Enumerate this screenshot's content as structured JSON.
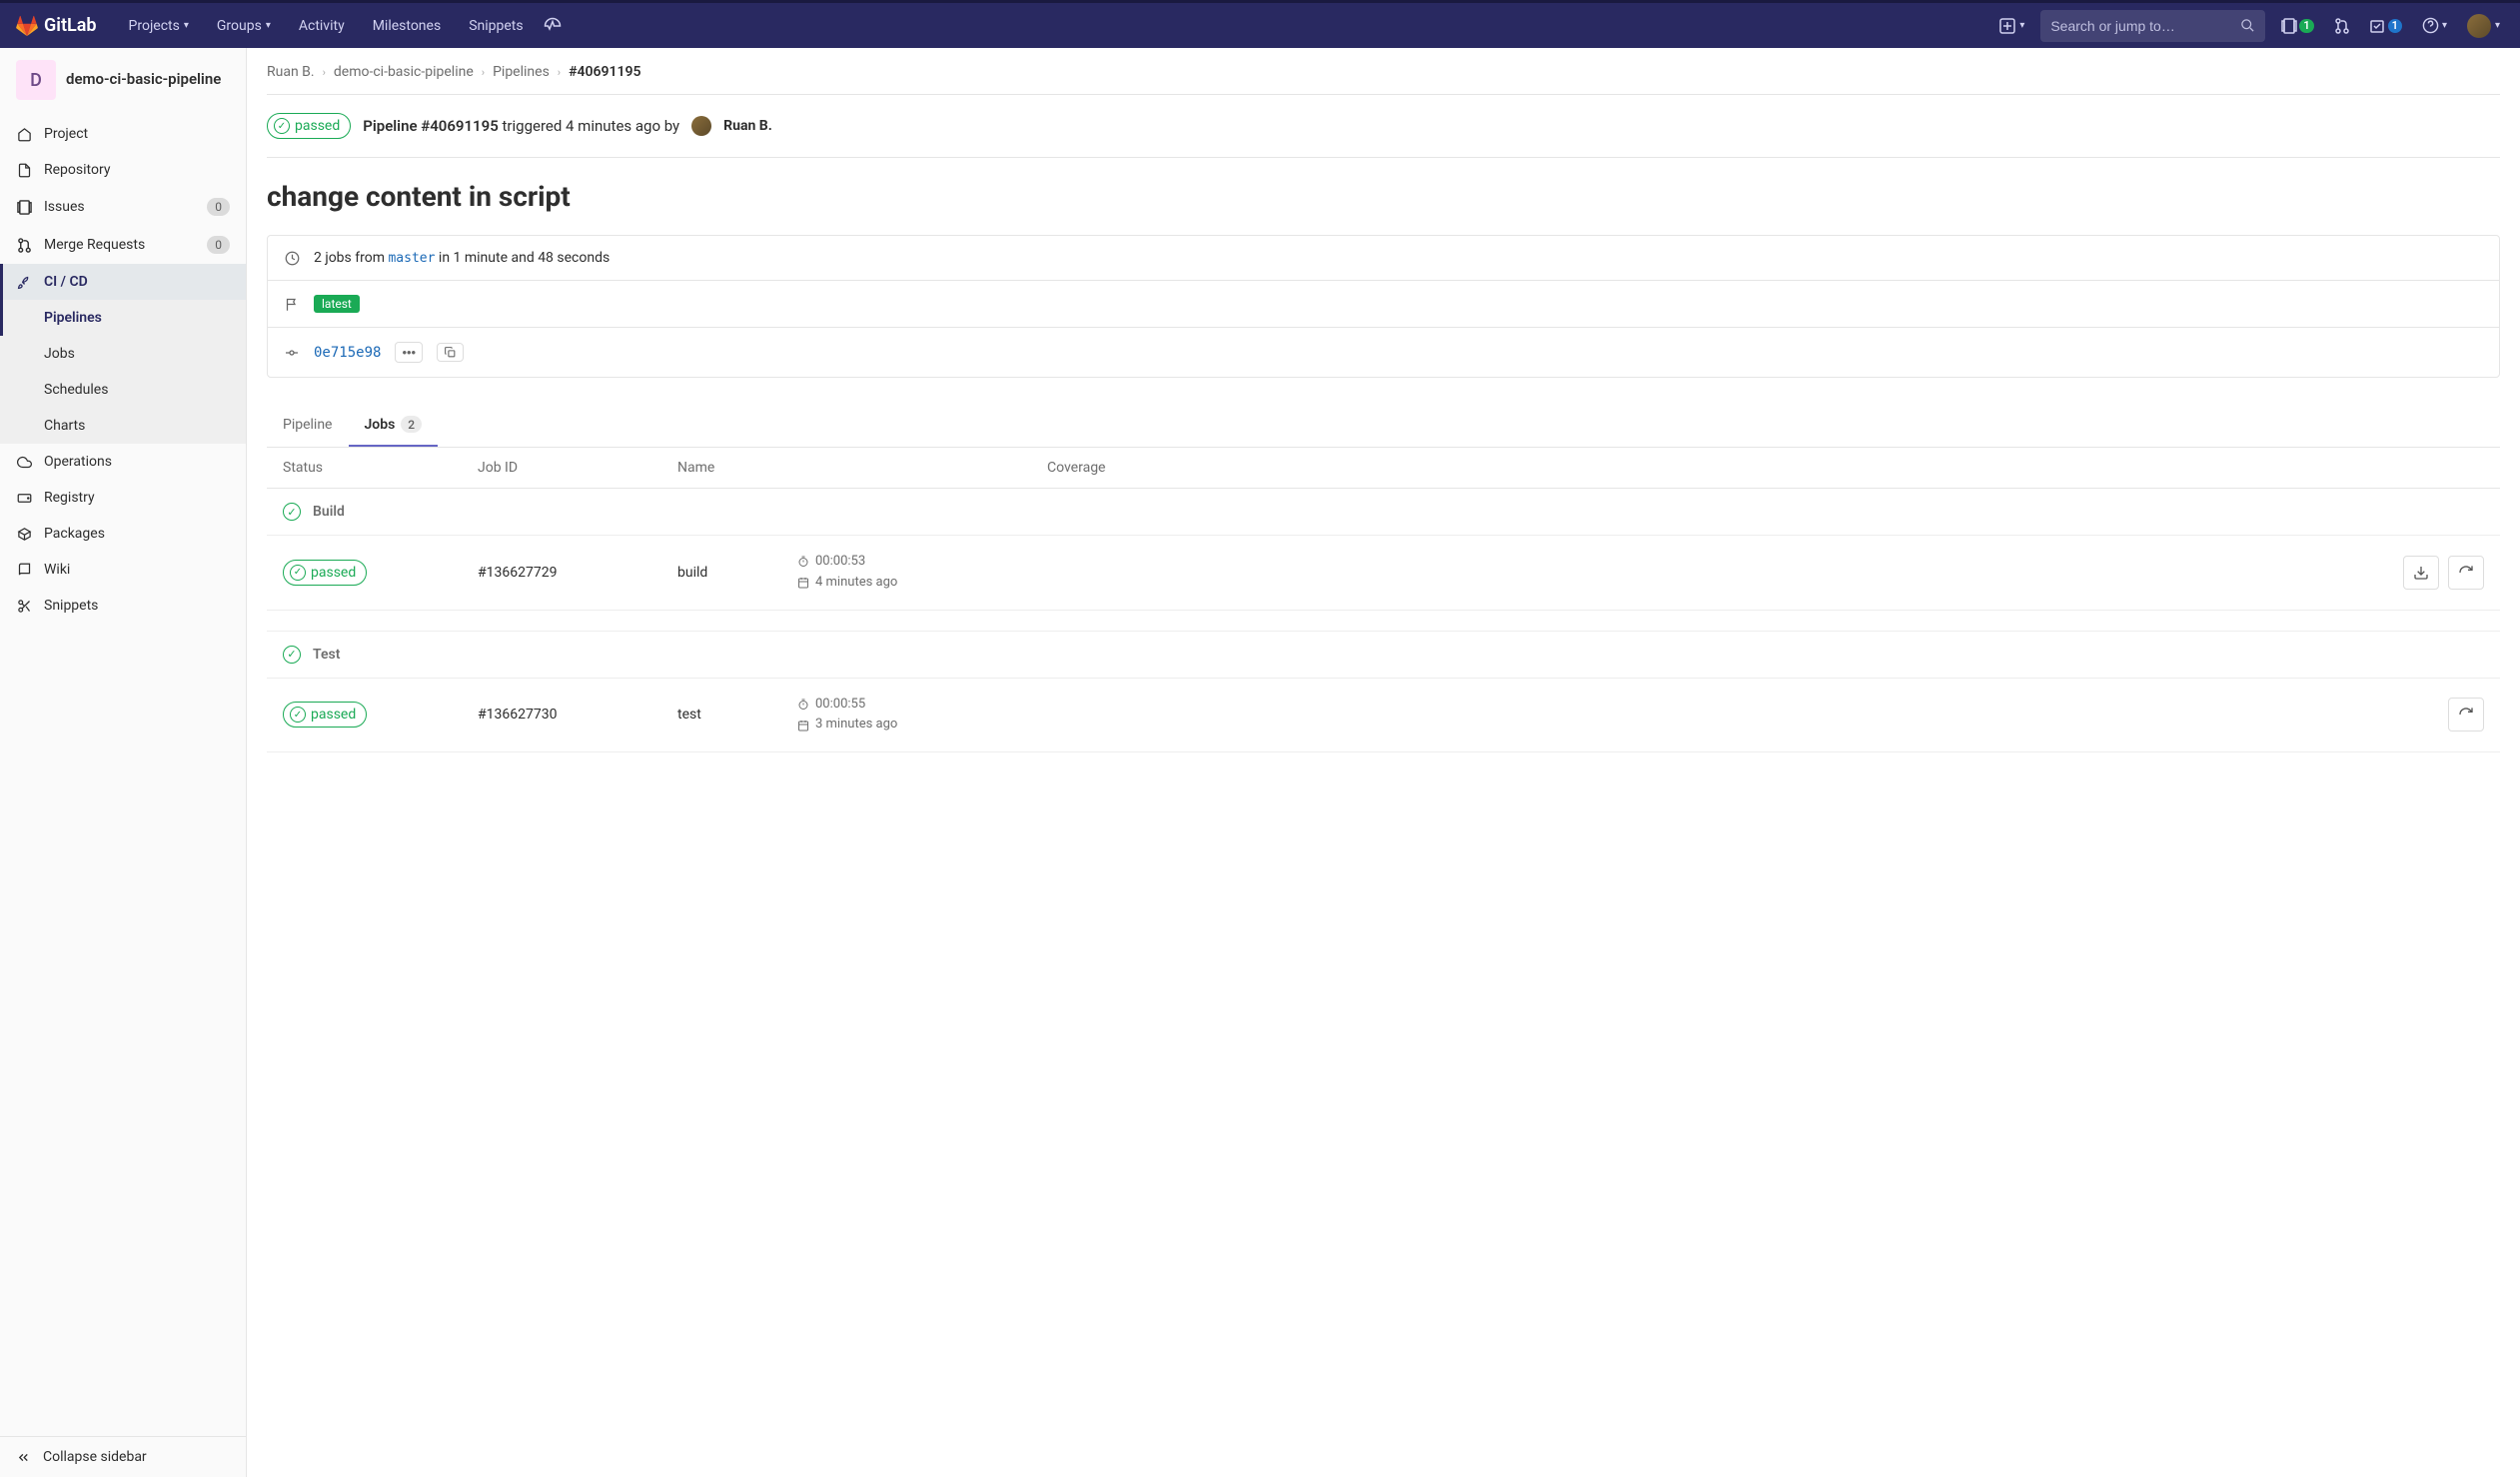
{
  "navbar": {
    "brand": "GitLab",
    "items": [
      "Projects",
      "Groups",
      "Activity",
      "Milestones",
      "Snippets"
    ],
    "search_placeholder": "Search or jump to…",
    "issues_badge": "1",
    "todos_badge": "1"
  },
  "sidebar": {
    "project_initial": "D",
    "project_name": "demo-ci-basic-pipeline",
    "items": [
      {
        "icon": "home",
        "label": "Project"
      },
      {
        "icon": "file",
        "label": "Repository"
      },
      {
        "icon": "issues",
        "label": "Issues",
        "badge": "0"
      },
      {
        "icon": "merge",
        "label": "Merge Requests",
        "badge": "0"
      },
      {
        "icon": "rocket",
        "label": "CI / CD",
        "active": true,
        "sub": [
          {
            "label": "Pipelines",
            "active": true
          },
          {
            "label": "Jobs"
          },
          {
            "label": "Schedules"
          },
          {
            "label": "Charts"
          }
        ]
      },
      {
        "icon": "ops",
        "label": "Operations"
      },
      {
        "icon": "registry",
        "label": "Registry"
      },
      {
        "icon": "package",
        "label": "Packages"
      },
      {
        "icon": "wiki",
        "label": "Wiki"
      },
      {
        "icon": "snippet",
        "label": "Snippets"
      }
    ],
    "collapse": "Collapse sidebar"
  },
  "breadcrumbs": [
    "Ruan B.",
    "demo-ci-basic-pipeline",
    "Pipelines",
    "#40691195"
  ],
  "pipeline": {
    "status": "passed",
    "id_label": "Pipeline #40691195",
    "triggered_text": "triggered 4 minutes ago by",
    "user": "Ruan B.",
    "commit_title": "change content in script",
    "jobs_summary_prefix": "2 jobs from",
    "branch": "master",
    "jobs_summary_suffix": "in 1 minute and 48 seconds",
    "tag": "latest",
    "commit_sha": "0e715e98"
  },
  "tabs": {
    "pipeline": "Pipeline",
    "jobs": "Jobs",
    "jobs_count": "2"
  },
  "table": {
    "headers": {
      "status": "Status",
      "jobid": "Job ID",
      "name": "Name",
      "coverage": "Coverage"
    },
    "stages": [
      {
        "name": "Build",
        "jobs": [
          {
            "status": "passed",
            "id": "#136627729",
            "name": "build",
            "duration": "00:00:53",
            "finished": "4 minutes ago",
            "download": true
          }
        ]
      },
      {
        "name": "Test",
        "jobs": [
          {
            "status": "passed",
            "id": "#136627730",
            "name": "test",
            "duration": "00:00:55",
            "finished": "3 minutes ago",
            "download": false
          }
        ]
      }
    ]
  }
}
